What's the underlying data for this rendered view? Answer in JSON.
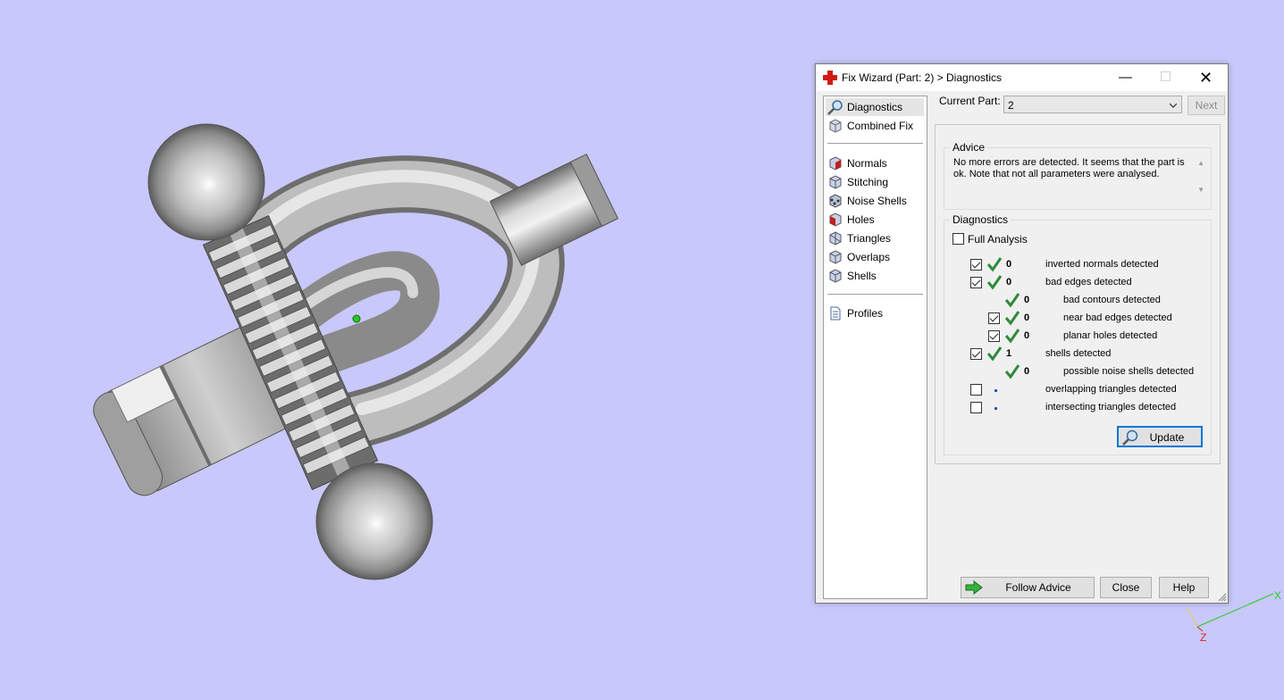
{
  "dialog": {
    "title": "Fix Wizard (Part: 2) > Diagnostics",
    "controls": {
      "minimize": "—",
      "maximize": "☐",
      "close": "✕"
    }
  },
  "nav": {
    "items": [
      {
        "label": "Diagnostics",
        "icon": "magnifier-icon",
        "selected": true
      },
      {
        "label": "Combined Fix",
        "icon": "cube-icon"
      },
      {
        "label": "Normals",
        "icon": "normals-cube-icon"
      },
      {
        "label": "Stitching",
        "icon": "stitching-cube-icon"
      },
      {
        "label": "Noise Shells",
        "icon": "noise-shells-icon"
      },
      {
        "label": "Holes",
        "icon": "holes-cube-icon"
      },
      {
        "label": "Triangles",
        "icon": "triangles-cube-icon"
      },
      {
        "label": "Overlaps",
        "icon": "overlaps-cube-icon"
      },
      {
        "label": "Shells",
        "icon": "shells-cube-icon"
      },
      {
        "label": "Profiles",
        "icon": "document-icon"
      }
    ]
  },
  "current_part": {
    "label": "Current Part:",
    "value": "2",
    "next_label": "Next"
  },
  "advice": {
    "title": "Advice",
    "text": "No more errors are detected. It seems that the part is ok. Note that not all parameters were analysed."
  },
  "diagnostics": {
    "title": "Diagnostics",
    "full_analysis_label": "Full Analysis",
    "full_analysis_checked": false,
    "rows": [
      {
        "checkbox": true,
        "checked": true,
        "status": "ok",
        "count": "0",
        "label": "inverted normals detected",
        "indent": 0
      },
      {
        "checkbox": true,
        "checked": true,
        "status": "ok",
        "count": "0",
        "label": "bad edges detected",
        "indent": 0
      },
      {
        "checkbox": false,
        "checked": false,
        "status": "ok",
        "count": "0",
        "label": "bad contours detected",
        "indent": 1
      },
      {
        "checkbox": true,
        "checked": true,
        "status": "ok",
        "count": "0",
        "label": "near bad edges detected",
        "indent": 1
      },
      {
        "checkbox": true,
        "checked": true,
        "status": "ok",
        "count": "0",
        "label": "planar holes detected",
        "indent": 1
      },
      {
        "checkbox": true,
        "checked": true,
        "status": "ok",
        "count": "1",
        "label": "shells detected",
        "indent": 0
      },
      {
        "checkbox": false,
        "checked": false,
        "status": "ok",
        "count": "0",
        "label": "possible noise shells detected",
        "indent": 1
      },
      {
        "checkbox": true,
        "checked": false,
        "status": "pending",
        "count": "",
        "label": "overlapping triangles detected",
        "indent": 0
      },
      {
        "checkbox": true,
        "checked": false,
        "status": "pending",
        "count": "",
        "label": "intersecting triangles detected",
        "indent": 0
      }
    ],
    "update_label": "Update"
  },
  "buttons": {
    "follow_advice": "Follow Advice",
    "close": "Close",
    "help": "Help"
  },
  "axes": {
    "x_label": "X",
    "z_label": "Z"
  },
  "colors": {
    "viewport_background": "#c8c8fa",
    "check_green": "#2e8b3a",
    "accent_blue": "#0078d7",
    "axis_x": "#22cc22",
    "axis_z": "#dd2222"
  }
}
